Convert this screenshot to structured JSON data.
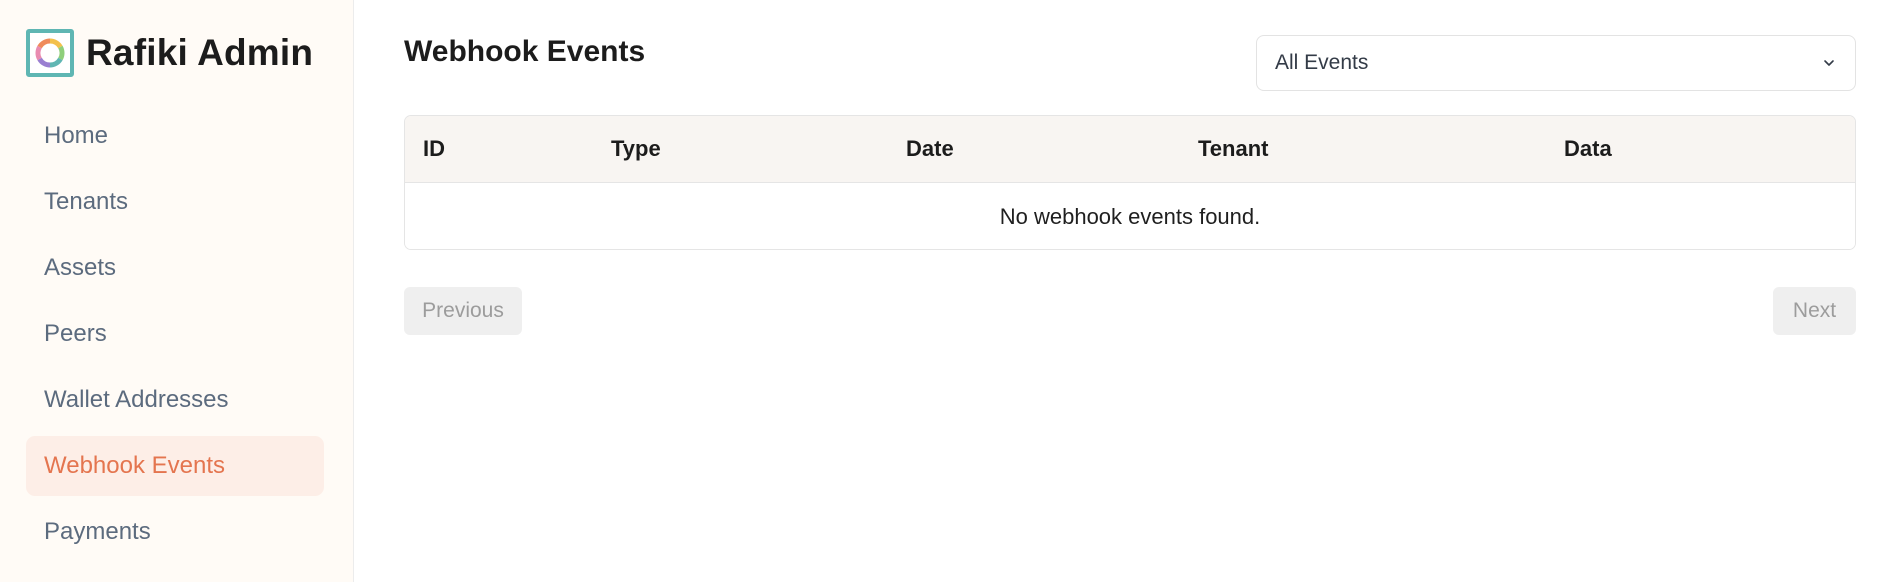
{
  "brand": {
    "title": "Rafiki Admin",
    "logo_icon": "ring-logo-icon",
    "logo_border_color": "#5fb6b3"
  },
  "sidebar": {
    "items": [
      {
        "label": "Home",
        "active": false
      },
      {
        "label": "Tenants",
        "active": false
      },
      {
        "label": "Assets",
        "active": false
      },
      {
        "label": "Peers",
        "active": false
      },
      {
        "label": "Wallet Addresses",
        "active": false
      },
      {
        "label": "Webhook Events",
        "active": true
      },
      {
        "label": "Payments",
        "active": false
      }
    ],
    "active_color": "#e4754f",
    "active_bg": "#fdeee7"
  },
  "main": {
    "title": "Webhook Events",
    "filter": {
      "selected": "All Events",
      "icon": "chevron-down-icon"
    },
    "table": {
      "columns": [
        "ID",
        "Type",
        "Date",
        "Tenant",
        "Data"
      ],
      "empty_message": "No webhook events found."
    },
    "pagination": {
      "previous_label": "Previous",
      "next_label": "Next",
      "previous_disabled": true,
      "next_disabled": true
    }
  }
}
